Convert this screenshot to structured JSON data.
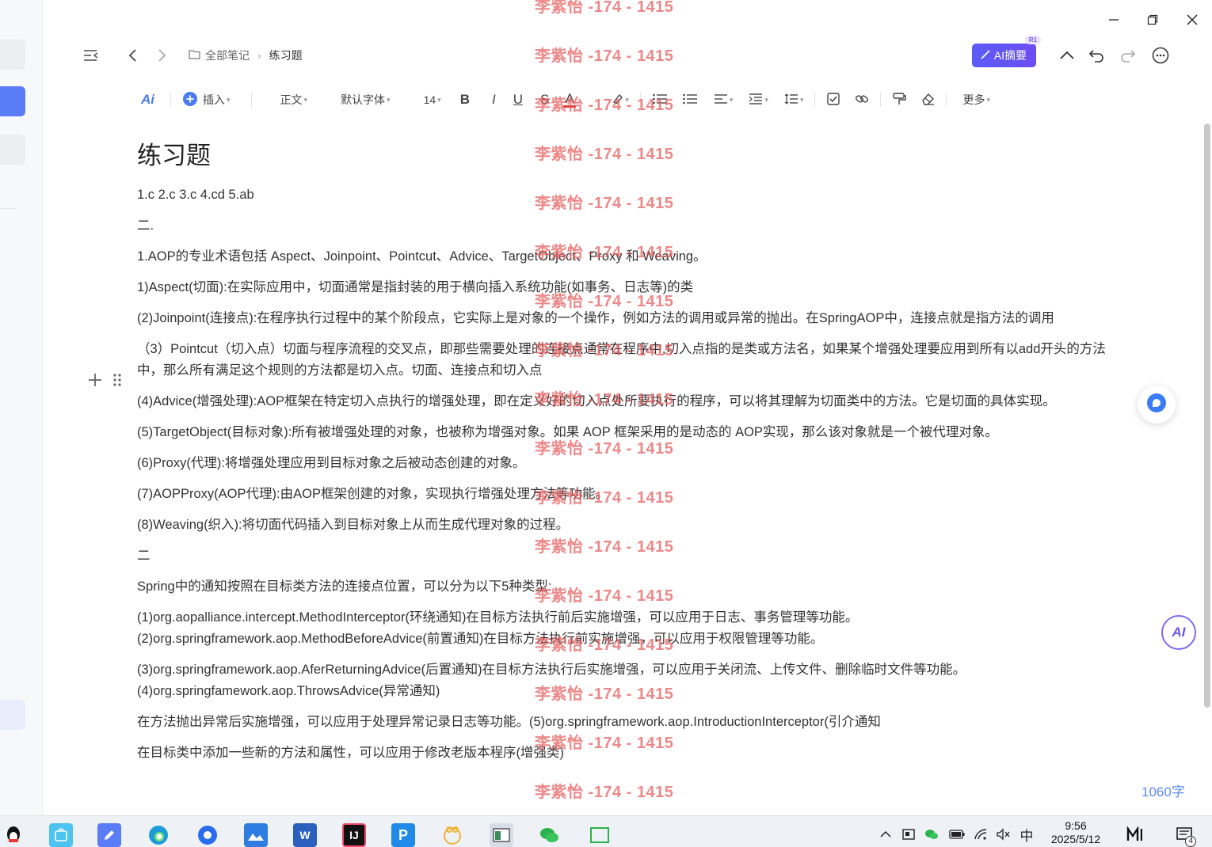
{
  "breadcrumb": {
    "root": "全部笔记",
    "current": "练习题"
  },
  "header": {
    "ai_summary_label": "AI摘要",
    "ai_badge": "R1"
  },
  "toolbar": {
    "ai": "Ai",
    "insert": "插入",
    "style": "正文",
    "font": "默认字体",
    "size": "14",
    "bold": "B",
    "italic": "I",
    "underline": "U",
    "strike": "S",
    "font_color": "A",
    "more": "更多"
  },
  "doc": {
    "title": "练习题",
    "paragraphs": [
      "1.c 2.c 3.c 4.cd 5.ab",
      "二.",
      "1.AOP的专业术语包括 Aspect、Joinpoint、Pointcut、Advice、TargetObject、Proxy 和 Weaving。",
      "1)Aspect(切面):在实际应用中，切面通常是指封装的用于横向插入系统功能(如事务、日志等)的类",
      "(2)Joinpoint(连接点):在程序执行过程中的某个阶段点，它实际上是对象的一个操作，例如方法的调用或异常的抛出。在SpringAOP中，连接点就是指方法的调用",
      "（3）Pointcut（切入点）切面与程序流程的交叉点，即那些需要处理的连接点通常在程序中,切入点指的是类或方法名，如果某个增强处理要应用到所有以add开头的方法中，那么所有满足这个规则的方法都是切入点。切面、连接点和切入点",
      "(4)Advice(增强处理):AOP框架在特定切入点执行的增强处理，即在定义好的切入点处所要执行的程序，可以将其理解为切面类中的方法。它是切面的具体实现。",
      "(5)TargetObject(目标对象):所有被增强处理的对象，也被称为增强对象。如果 AOP 框架采用的是动态的 AOP实现，那么该对象就是一个被代理对象。",
      "(6)Proxy(代理):将增强处理应用到目标对象之后被动态创建的对象。",
      "(7)AOPProxy(AOP代理):由AOP框架创建的对象，实现执行增强处理方法等功能。",
      "(8)Weaving(织入):将切面代码插入到目标对象上从而生成代理对象的过程。",
      "二",
      "Spring中的通知按照在目标类方法的连接点位置，可以分为以下5种类型:",
      "(1)org.aopalliance.intercept.MethodInterceptor(环绕通知)在目标方法执行前后实施增强，可以应用于日志、事务管理等功能。",
      "(2)org.springframework.aop.MethodBeforeAdvice(前置通知)在目标方法执行前实施增强，可以应用于权限管理等功能。",
      "(3)org.springframework.aop.AferReturningAdvice(后置通知)在目标方法执行后实施增强，可以应用于关闭流、上传文件、删除临时文件等功能。",
      "(4)org.springfamework.aop.ThrowsAdvice(异常通知)",
      "在方法抛出异常后实施增强，可以应用于处理异常记录日志等功能。(5)org.springframework.aop.IntroductionInterceptor(引介通知",
      "在目标类中添加一些新的方法和属性，可以应用于修改老版本程序(增强类)"
    ]
  },
  "watermark": "李紫怡 -174 - 1415",
  "word_count": "1060字",
  "floating": {
    "ai_label": "AI"
  },
  "taskbar": {
    "time": "9:56",
    "date": "2025/5/12",
    "ime": "中",
    "notif_count": "4"
  },
  "colors": {
    "accent": "#5b5cf6",
    "watermark": "#e65a5a",
    "link": "#5b8def"
  }
}
